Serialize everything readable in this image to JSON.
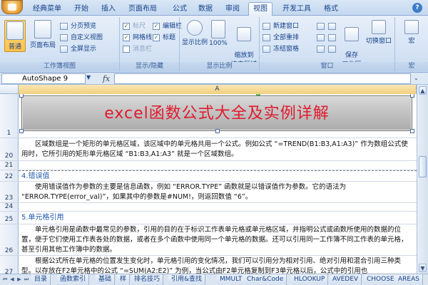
{
  "ribbon": {
    "tabs": [
      "经典菜单",
      "开始",
      "插入",
      "页面布局",
      "公式",
      "数据",
      "审阅",
      "视图",
      "开发工具",
      "格式"
    ],
    "active_tab": "视图",
    "groups": {
      "workbook_views": {
        "label": "工作簿视图",
        "normal": "普通",
        "page_layout": "页面布局",
        "page_break": "分页预览",
        "custom_views": "自定义视图",
        "full_screen": "全屏显示"
      },
      "show_hide": {
        "label": "显示/隐藏",
        "ruler": "标尺",
        "gridlines": "网格线",
        "message_bar": "消息栏",
        "formula_bar": "编辑栏",
        "headings": "标题"
      },
      "zoom": {
        "label": "显示比例",
        "zoom": "显示比例",
        "zoom100": "100%",
        "zoom_selection": "缩放到\n选定区域"
      },
      "window": {
        "label": "窗口",
        "new_window": "新建窗口",
        "arrange_all": "全部重排",
        "freeze_panes": "冻结窗格",
        "save_workspace": "保存\n工作区",
        "switch_windows": "切换窗口"
      },
      "macros": {
        "label": "宏",
        "macros": "宏"
      }
    }
  },
  "formula_bar": {
    "name_box": "AutoShape 9",
    "fx": "fx",
    "value": ""
  },
  "sheet": {
    "column": "A",
    "banner_title": "excel函数公式大全及实例详解",
    "rows": [
      {
        "num": "1",
        "text": ""
      },
      {
        "num": "20",
        "text": "　　区域数组是一个矩形的单元格区域，该区域中的单元格共用一个公式。例如公式 “=TREND(B1:B3,A1:A3)” 作为数组公式使用时，它所引用的矩形单元格区域 “B1:B3,A1:A3” 就是一个区域数组。"
      },
      {
        "num": "21",
        "text": ""
      },
      {
        "num": "22",
        "text": "4.错误值"
      },
      {
        "num": "23",
        "text": "　　使用错误值作为参数的主要是信息函数，例如 “ERROR.TYPE” 函数就是以错误值作为参数。它的语法为 “ERROR.TYPE(error_val)”，如果其中的参数是#NUM!，则返回数值 “6”。"
      },
      {
        "num": "24",
        "text": ""
      },
      {
        "num": "25",
        "text": "5.单元格引用"
      },
      {
        "num": "26",
        "text": "　　单元格引用是函数中最常见的参数，引用的目的在于标识工作表单元格或单元格区域，并指明公式或函数所使用的数据的位置，便于它们使用工作表各处的数据，或者在多个函数中使用同一个单元格的数据。还可以引用同一工作簿不同工作表的单元格，甚至引用其他工作簿中的数据。"
      },
      {
        "num": "27",
        "text": "　　根据公式所在单元格的位置发生变化时，单元格引用的变化情况，我们可以引用分为相对引用、绝对引用和混合引用三种类型。以存放在F2单元格中的公式 “=SUM(A2:E2)” 为例，当公式由F2单元格复制到F3单元格以后，公式中的引用也"
      }
    ]
  },
  "sheet_tabs": [
    "目录",
    "函数索引",
    "基础",
    "样",
    "排名技巧",
    "引用&查找",
    "MMULT",
    "Char&Code",
    "HLOOKUP",
    "AVEDEV",
    "CHOOSE",
    "AREAS"
  ],
  "colors": {
    "title_red": "#e01b2d",
    "heading_blue": "#1f5bb0",
    "ribbon_accent": "#ffc247"
  }
}
